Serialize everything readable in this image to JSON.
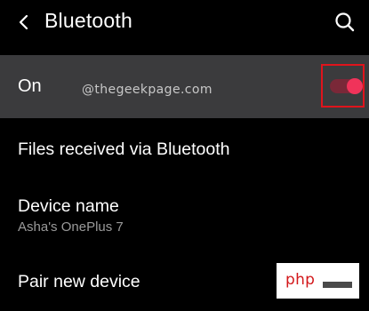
{
  "header": {
    "title": "Bluetooth",
    "back_icon": "arrow-left-icon",
    "search_icon": "search-icon"
  },
  "bluetooth_toggle_row": {
    "label": "On",
    "state": true,
    "accent_color": "#f0335a",
    "track_color": "#7a2838",
    "highlight_color": "#e0141c"
  },
  "watermark": {
    "text": "@thegeekpage.com"
  },
  "settings_items": [
    {
      "label": "Files received via Bluetooth"
    },
    {
      "label": "Device name",
      "value": "Asha's OnePlus 7"
    },
    {
      "label": "Pair new device"
    }
  ],
  "php_badge": {
    "text": "php",
    "color": "#d3181b"
  }
}
